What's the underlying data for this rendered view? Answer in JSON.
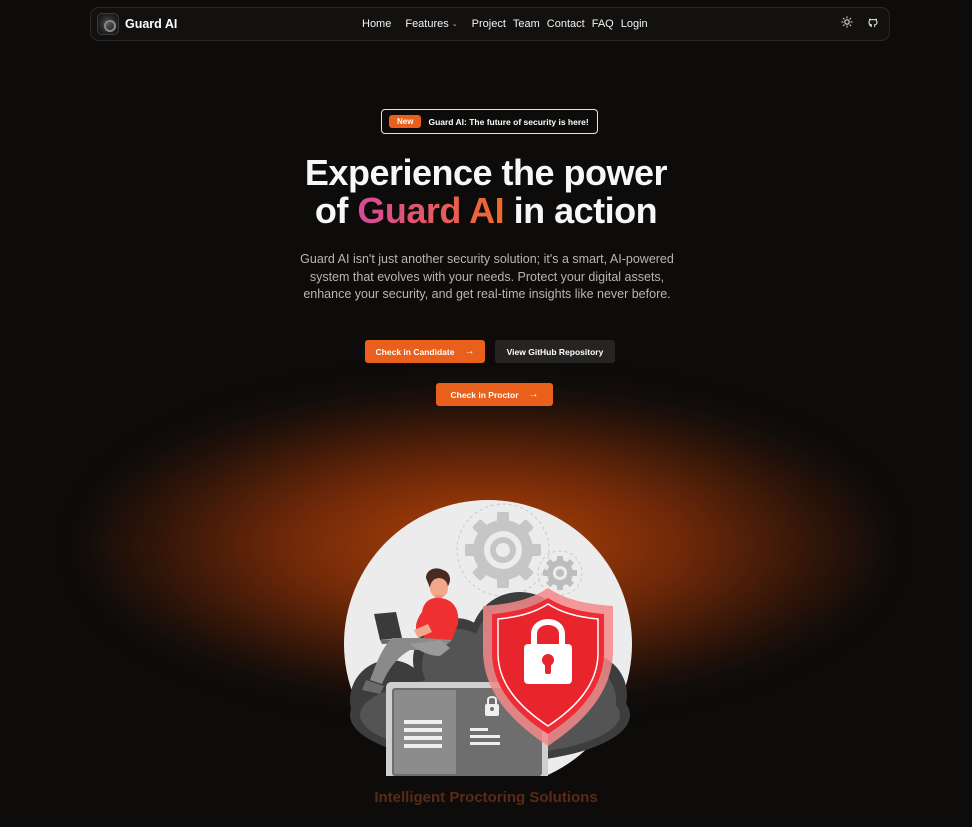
{
  "brand": {
    "name": "Guard AI"
  },
  "nav": {
    "home": "Home",
    "features": "Features",
    "project": "Project",
    "team": "Team",
    "contact": "Contact",
    "faq": "FAQ",
    "login": "Login",
    "icons": [
      "sun-icon",
      "github-icon"
    ]
  },
  "badge": {
    "tag": "New",
    "text": "Guard AI: The future of security is here!"
  },
  "hero": {
    "title_line1": "Experience the power",
    "title_of": "of",
    "title_highlight": "Guard AI",
    "title_rest": "in action",
    "description": "Guard AI isn't just another security solution; it's a smart, AI-powered system that evolves with your needs. Protect your digital assets, enhance your security, and get real-time insights like never before."
  },
  "buttons": {
    "candidate": "Check in Candidate",
    "github": "View GitHub Repository",
    "proctor": "Check in Proctor"
  },
  "caption": "Intelligent Proctoring Solutions",
  "colors": {
    "accent": "#e8601c",
    "background": "#0d0c0b",
    "shield": "#e8242c"
  }
}
